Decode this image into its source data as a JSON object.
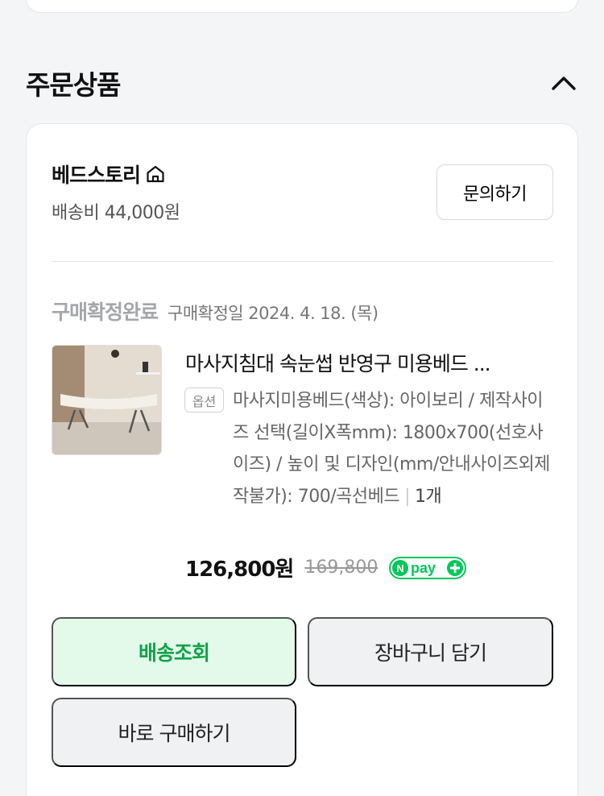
{
  "section": {
    "title": "주문상품"
  },
  "seller": {
    "name": "베드스토리",
    "shipping_fee": "배송비 44,000원",
    "inquiry_label": "문의하기"
  },
  "order": {
    "status": "구매확정완료",
    "confirm_date": "구매확정일 2024. 4. 18. (목)"
  },
  "product": {
    "title": "마사지침대 속눈썹 반영구 미용베드 ...",
    "option_badge": "옵션",
    "option_text": "마사지미용베드(색상): 아이보리 / 제작사이즈 선택(길이X폭mm): 1800x700(선호사이즈) / 높이 및 디자인(mm/안내사이즈외제작불가): 700/곡선베드",
    "quantity": "1개",
    "price": "126,800원",
    "original_price": "169,800",
    "npay_label": "pay"
  },
  "actions": {
    "track_label": "배송조회",
    "cart_label": "장바구니 담기",
    "buy_label": "바로 구매하기"
  },
  "colors": {
    "accent_green": "#11a347",
    "track_bg": "#e3faeb",
    "npay_green": "#03c75a"
  }
}
